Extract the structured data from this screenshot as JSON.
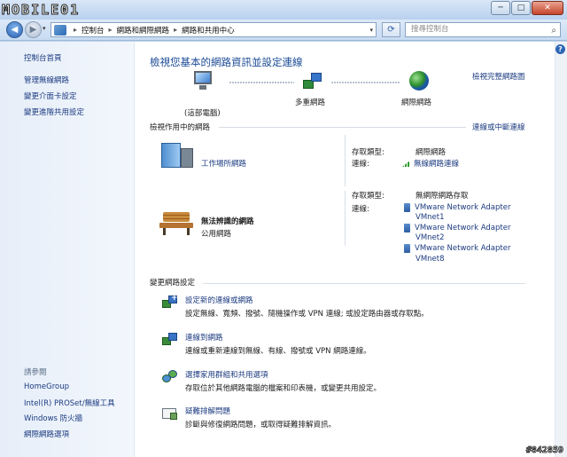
{
  "logo_text": "MOBILE01",
  "window": {
    "min_label": "─",
    "max_label": "□",
    "close_label": "✕"
  },
  "nav": {
    "back_glyph": "◀",
    "forward_glyph": "▶",
    "dropdown_glyph": "▾",
    "breadcrumb": [
      "控制台",
      "網路和網際網路",
      "網路和共用中心"
    ],
    "crumb_sep": "▸",
    "refresh_glyph": "⟳",
    "search_placeholder": "搜尋控制台",
    "search_glyph": "⌕"
  },
  "sidebar": {
    "links": [
      "控制台首頁",
      "管理無線網路",
      "變更介面卡設定",
      "變更進階共用設定"
    ],
    "see_also_label": "請參閱",
    "see_also": [
      "HomeGroup",
      "Intel(R) PROSet/無線工具",
      "Windows 防火牆",
      "網際網路選項"
    ]
  },
  "main": {
    "help_glyph": "?",
    "heading": "檢視您基本的網路資訊並設定連線",
    "full_map_link": "檢視完整網路圖",
    "map": {
      "pc_label": "(這部電腦)",
      "multi_label": "多重網路",
      "internet_label": "網際網路"
    },
    "active_title": "檢視作用中的網路",
    "connect_disconnect": "連線或中斷連線",
    "networks": [
      {
        "name": "工作場所網路",
        "access_type_key": "存取類型:",
        "access_type_val": "網際網路",
        "connection_key": "連線:",
        "connection_val": "無線網路連線"
      },
      {
        "name": "無法辨識的網路",
        "category": "公用網路",
        "access_type_key": "存取類型:",
        "access_type_val": "無網際網路存取",
        "connection_key": "連線:",
        "adapters": [
          [
            "VMware Network Adapter",
            "VMnet1"
          ],
          [
            "VMware Network Adapter",
            "VMnet2"
          ],
          [
            "VMware Network Adapter",
            "VMnet8"
          ]
        ]
      }
    ],
    "change_title": "變更網路設定",
    "tasks": [
      {
        "link": "設定新的連線或網路",
        "desc": "設定無線、寬頻、撥號、隨機操作或 VPN 連線; 或設定路由器或存取點。"
      },
      {
        "link": "連線到網路",
        "desc": "連線或重新連線到無線、有線、撥號或 VPN 網路連線。"
      },
      {
        "link": "選擇家用群組和共用選項",
        "desc": "存取位於其他網路電腦的檔案和印表機，或變更共用設定。"
      },
      {
        "link": "疑難排解問題",
        "desc": "診斷與修復網路問題，或取得疑難排解資訊。"
      }
    ]
  },
  "watermark": "#842859"
}
